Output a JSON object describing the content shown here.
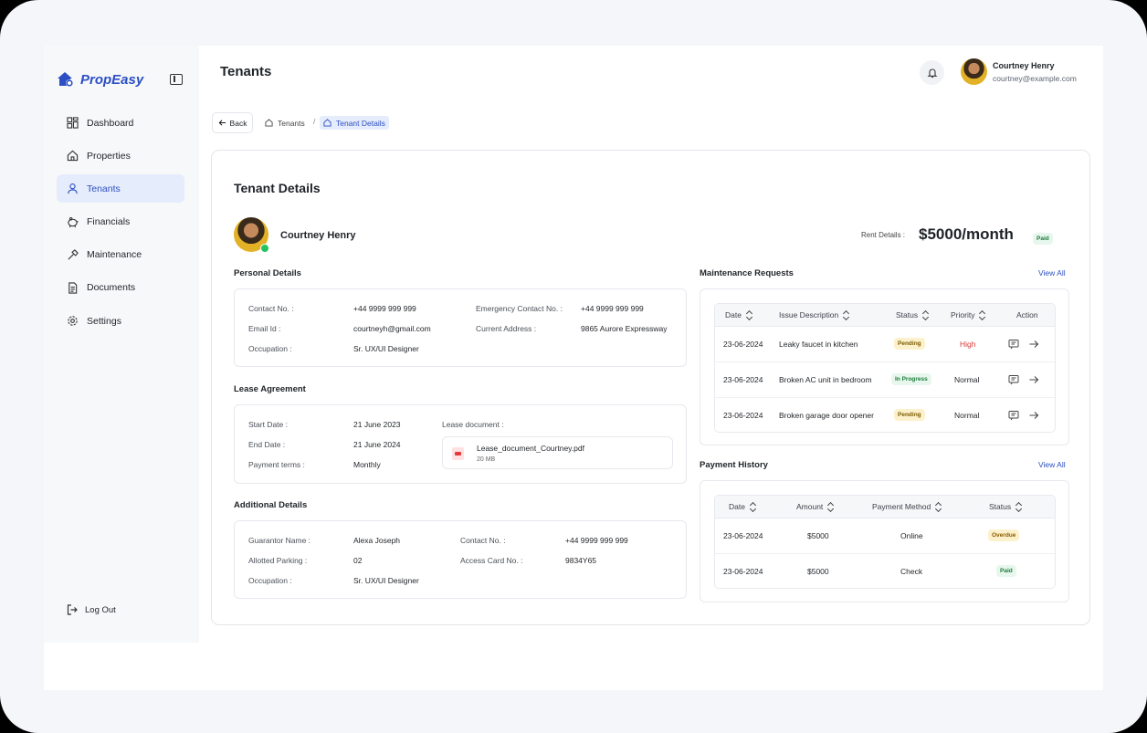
{
  "app": {
    "brand": "PropEasy",
    "page_title": "Tenants"
  },
  "sidebar": {
    "items": [
      {
        "label": "Dashboard"
      },
      {
        "label": "Properties"
      },
      {
        "label": "Tenants"
      },
      {
        "label": "Financials"
      },
      {
        "label": "Maintenance"
      },
      {
        "label": "Documents"
      },
      {
        "label": "Settings"
      }
    ],
    "logout": "Log Out"
  },
  "header": {
    "user_name": "Courtney Henry",
    "user_email": "courtney@example.com"
  },
  "breadcrumb": {
    "back": "Back",
    "items": [
      "Tenants",
      "Tenant Details"
    ],
    "separator": "/"
  },
  "tenant": {
    "card_title": "Tenant Details",
    "name": "Courtney Henry",
    "rent_label": "Rent Details :",
    "rent_value": "$5000/month",
    "rent_status": "Paid"
  },
  "personal": {
    "title": "Personal Details",
    "contact_label": "Contact No. :",
    "contact_value": "+44 9999 999 999",
    "email_label": "Email Id :",
    "email_value": "courtneyh@gmail.com",
    "occupation_label": "Occupation :",
    "occupation_value": "Sr. UX/UI Designer",
    "emergency_label": "Emergency Contact No. :",
    "emergency_value": "+44 9999 999 999",
    "address_label": "Current Address :",
    "address_value": "9865 Aurore Expressway"
  },
  "lease": {
    "title": "Lease Agreement",
    "start_label": "Start Date :",
    "start_value": "21 June 2023",
    "end_label": "End Date :",
    "end_value": "21 June 2024",
    "terms_label": "Payment terms :",
    "terms_value": "Monthly",
    "doc_label": "Lease document :",
    "doc_name": "Lease_document_Courtney.pdf",
    "doc_size": "20 MB"
  },
  "additional": {
    "title": "Additional Details",
    "guarantor_label": "Guarantor Name :",
    "guarantor_value": "Alexa Joseph",
    "parking_label": "Allotted Parking :",
    "parking_value": "02",
    "occupation_label": "Occupation :",
    "occupation_value": "Sr. UX/UI Designer",
    "contact_label": "Contact No. :",
    "contact_value": "+44 9999 999 999",
    "card_label": "Access Card No. :",
    "card_value": "9834Y65"
  },
  "maintenance": {
    "title": "Maintenance Requests",
    "view_all": "View All",
    "columns": [
      "Date",
      "Issue Description",
      "Status",
      "Priority",
      "Action"
    ],
    "rows": [
      {
        "date": "23-06-2024",
        "issue": "Leaky faucet in kitchen",
        "status": "Pending",
        "priority": "High"
      },
      {
        "date": "23-06-2024",
        "issue": "Broken AC unit in bedroom",
        "status": "In Progress",
        "priority": "Normal"
      },
      {
        "date": "23-06-2024",
        "issue": "Broken garage door opener",
        "status": "Pending",
        "priority": "Normal"
      }
    ]
  },
  "payments": {
    "title": "Payment History",
    "view_all": "View All",
    "columns": [
      "Date",
      "Amount",
      "Payment Method",
      "Status"
    ],
    "rows": [
      {
        "date": "23-06-2024",
        "amount": "$5000",
        "method": "Online",
        "status": "Overdue"
      },
      {
        "date": "23-06-2024",
        "amount": "$5000",
        "method": "Check",
        "status": "Paid"
      }
    ]
  },
  "colors": {
    "accent": "#2d4fc2",
    "active_bg": "#e5ecfb",
    "success": "#22c35e",
    "danger": "#d63a3a"
  }
}
